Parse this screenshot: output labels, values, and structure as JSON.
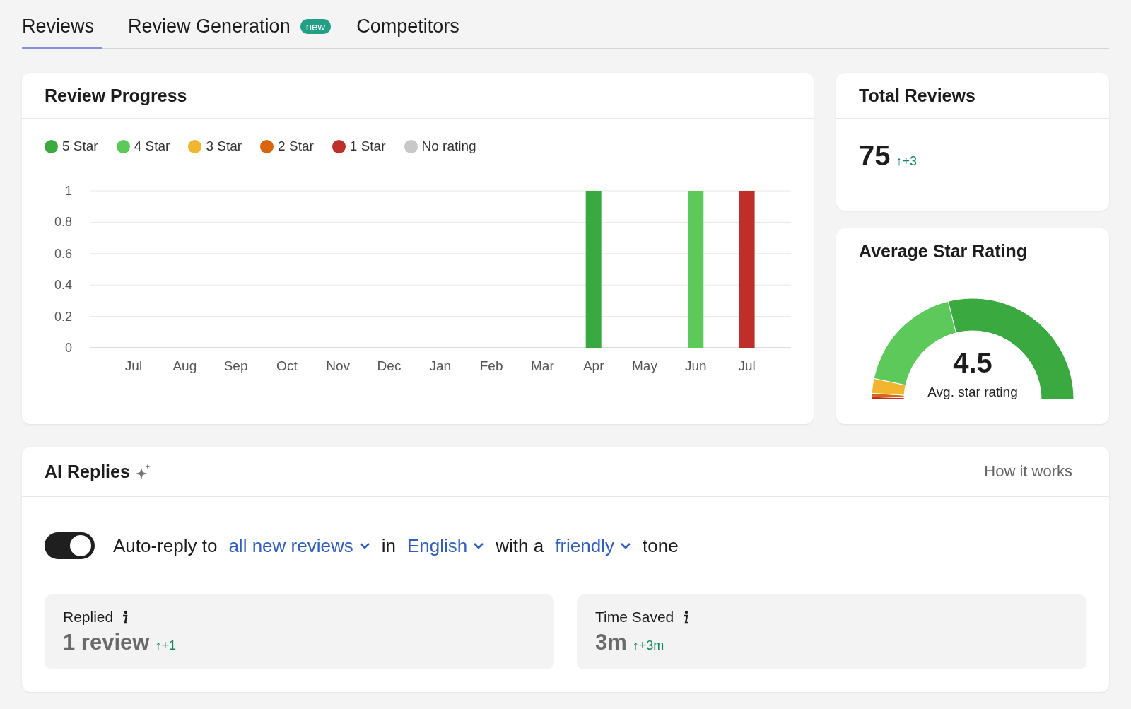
{
  "tabs": [
    {
      "label": "Reviews",
      "selected": true
    },
    {
      "label": "Review Generation",
      "badge": "new",
      "selected": false
    },
    {
      "label": "Competitors",
      "selected": false
    }
  ],
  "review_progress": {
    "title": "Review Progress",
    "chart_data": {
      "type": "bar",
      "stacked": true,
      "grid": true,
      "legend": "top",
      "categories": [
        "Jul",
        "Aug",
        "Sep",
        "Oct",
        "Nov",
        "Dec",
        "Jan",
        "Feb",
        "Mar",
        "Apr",
        "May",
        "Jun",
        "Jul"
      ],
      "ylim": [
        0,
        1
      ],
      "yticks": [
        0,
        {
          "value": 0.2,
          "label": "0.2"
        },
        {
          "value": 0.4,
          "label": "0.4"
        },
        {
          "value": 0.6,
          "label": "0.6"
        },
        {
          "value": 0.8,
          "label": "0.8"
        },
        1
      ],
      "series": [
        {
          "name": "5 Star",
          "color": "#3aaa40",
          "values": [
            0,
            0,
            0,
            0,
            0,
            0,
            0,
            0,
            0,
            1,
            0,
            0,
            0
          ]
        },
        {
          "name": "4 Star",
          "color": "#5cc95a",
          "values": [
            0,
            0,
            0,
            0,
            0,
            0,
            0,
            0,
            0,
            0,
            0,
            1,
            0
          ]
        },
        {
          "name": "3 Star",
          "color": "#f2b52f",
          "values": [
            0,
            0,
            0,
            0,
            0,
            0,
            0,
            0,
            0,
            0,
            0,
            0,
            0
          ]
        },
        {
          "name": "2 Star",
          "color": "#d9650f",
          "values": [
            0,
            0,
            0,
            0,
            0,
            0,
            0,
            0,
            0,
            0,
            0,
            0,
            0
          ]
        },
        {
          "name": "1 Star",
          "color": "#bf2f2a",
          "values": [
            0,
            0,
            0,
            0,
            0,
            0,
            0,
            0,
            0,
            0,
            0,
            0,
            1
          ]
        },
        {
          "name": "No rating",
          "color": "#c8c8c8",
          "values": [
            0,
            0,
            0,
            0,
            0,
            0,
            0,
            0,
            0,
            0,
            0,
            0,
            0
          ]
        }
      ]
    }
  },
  "total_reviews": {
    "title": "Total Reviews",
    "value": "75",
    "delta": "↑+3"
  },
  "average_rating": {
    "title": "Average Star Rating",
    "value": "4.5",
    "caption": "Avg. star rating"
  },
  "ai_replies": {
    "title": "AI Replies",
    "link": "How it works",
    "auto_reply_on": true,
    "sentence": [
      {
        "kind": "text",
        "text": "Auto-reply to"
      },
      {
        "kind": "dropdown",
        "text": "all new reviews"
      },
      {
        "kind": "text",
        "text": "in"
      },
      {
        "kind": "dropdown",
        "text": "English"
      },
      {
        "kind": "text",
        "text": "with a"
      },
      {
        "kind": "dropdown",
        "text": "friendly"
      },
      {
        "kind": "text",
        "text": "tone"
      }
    ],
    "stats": [
      {
        "label": "Replied",
        "value": "1 review",
        "delta": "↑+1"
      },
      {
        "label": "Time Saved",
        "value": "3m",
        "delta": "↑+3m"
      }
    ]
  }
}
